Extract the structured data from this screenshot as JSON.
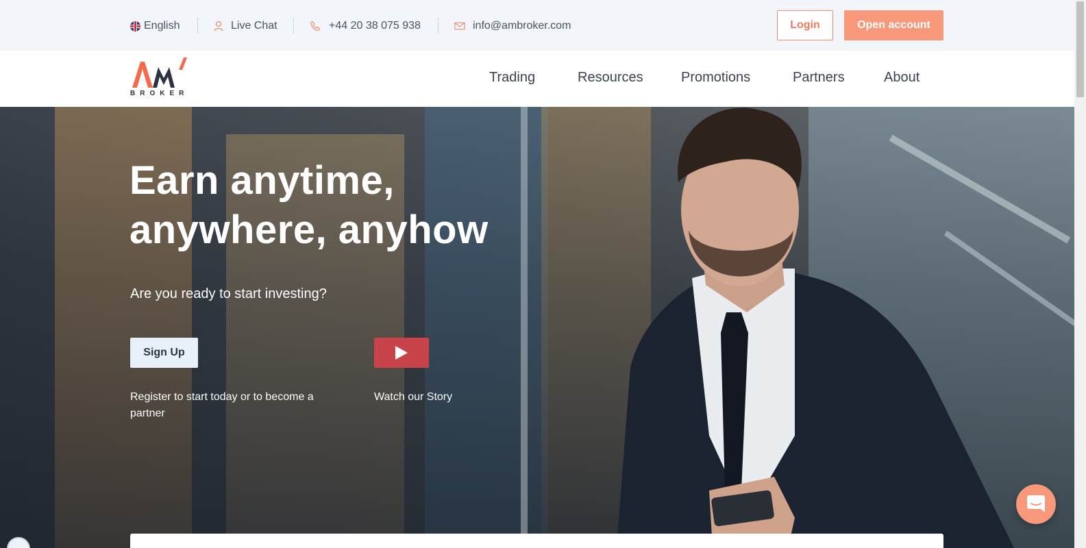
{
  "topbar": {
    "language": "English",
    "live_chat": "Live Chat",
    "phone": "+44 20 38 075 938",
    "email": "info@ambroker.com",
    "login_label": "Login",
    "open_account_label": "Open account"
  },
  "brand": {
    "logo_text": "BROKER",
    "accent_color": "#f7987b",
    "dark_color": "#2b3340"
  },
  "nav": {
    "items": [
      {
        "label": "Trading"
      },
      {
        "label": "Resources"
      },
      {
        "label": "Promotions"
      },
      {
        "label": "Partners"
      },
      {
        "label": "About"
      }
    ]
  },
  "hero": {
    "title_line1": "Earn anytime,",
    "title_line2": "anywhere, anyhow",
    "subtitle": "Are you ready to start investing?",
    "signup_label": "Sign Up",
    "signup_caption": "Register to start today or to become a partner",
    "watch_caption": "Watch our Story"
  },
  "icons": {
    "language": "uk-flag-icon",
    "live_chat": "user-icon",
    "phone": "phone-icon",
    "email": "mail-icon",
    "play": "play-icon",
    "chat_launcher": "chat-bubble-icon"
  }
}
